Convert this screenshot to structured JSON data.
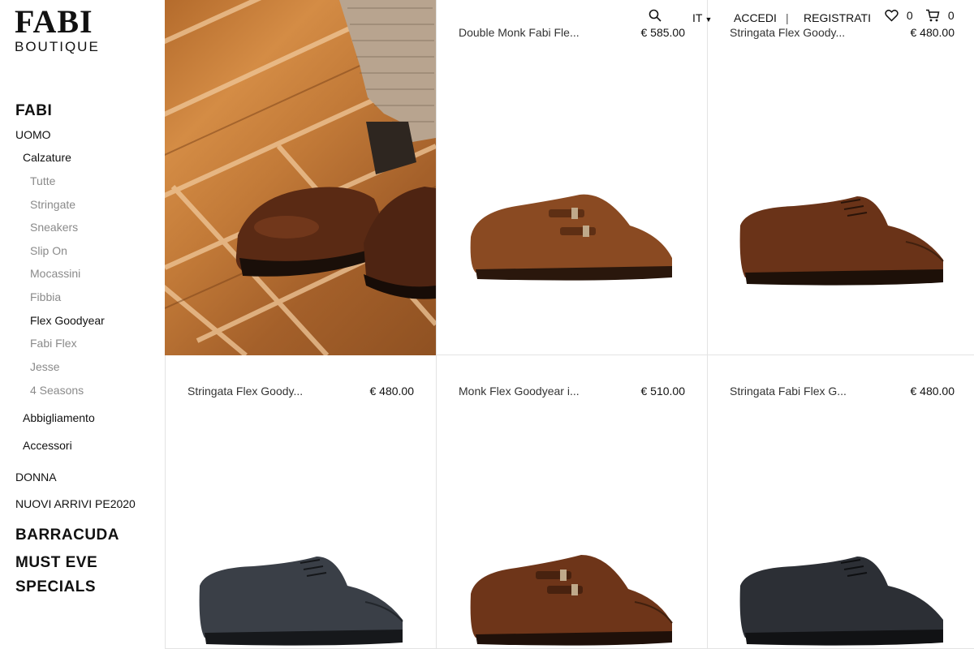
{
  "logo": {
    "main": "FABI",
    "sub": "BOUTIQUE"
  },
  "header": {
    "language": "IT",
    "login": "ACCEDI",
    "separator": "|",
    "register": "REGISTRATI",
    "wishlist_count": "0",
    "cart_count": "0"
  },
  "sidebar": {
    "brand_fabi": "FABI",
    "uomo": "UOMO",
    "calzature": "Calzature",
    "subcategories": [
      "Tutte",
      "Stringate",
      "Sneakers",
      "Slip On",
      "Mocassini",
      "Fibbia",
      "Flex Goodyear",
      "Fabi Flex",
      "Jesse",
      "4 Seasons"
    ],
    "active_subcategory": "Flex Goodyear",
    "abbigliamento": "Abbigliamento",
    "accessori": "Accessori",
    "donna": "DONNA",
    "nuovi_arrivi": "NUOVI ARRIVI PE2020",
    "brand_barracuda": "BARRACUDA",
    "brand_must_eve": "MUST EVE",
    "specials": "SPECIALS"
  },
  "products": [
    {
      "name": "Double Monk Fabi Fle...",
      "price": "€ 585.00",
      "color": "#8a4a22"
    },
    {
      "name": "Stringata Flex Goody...",
      "price": "€ 480.00",
      "color": "#6a3318"
    },
    {
      "name": "Stringata Flex Goody...",
      "price": "€ 480.00",
      "color": "#3a3f47"
    },
    {
      "name": "Monk Flex Goodyear i...",
      "price": "€ 510.00",
      "color": "#6e3519"
    },
    {
      "name": "Stringata Fabi Flex G...",
      "price": "€ 480.00",
      "color": "#2c2f35"
    }
  ]
}
